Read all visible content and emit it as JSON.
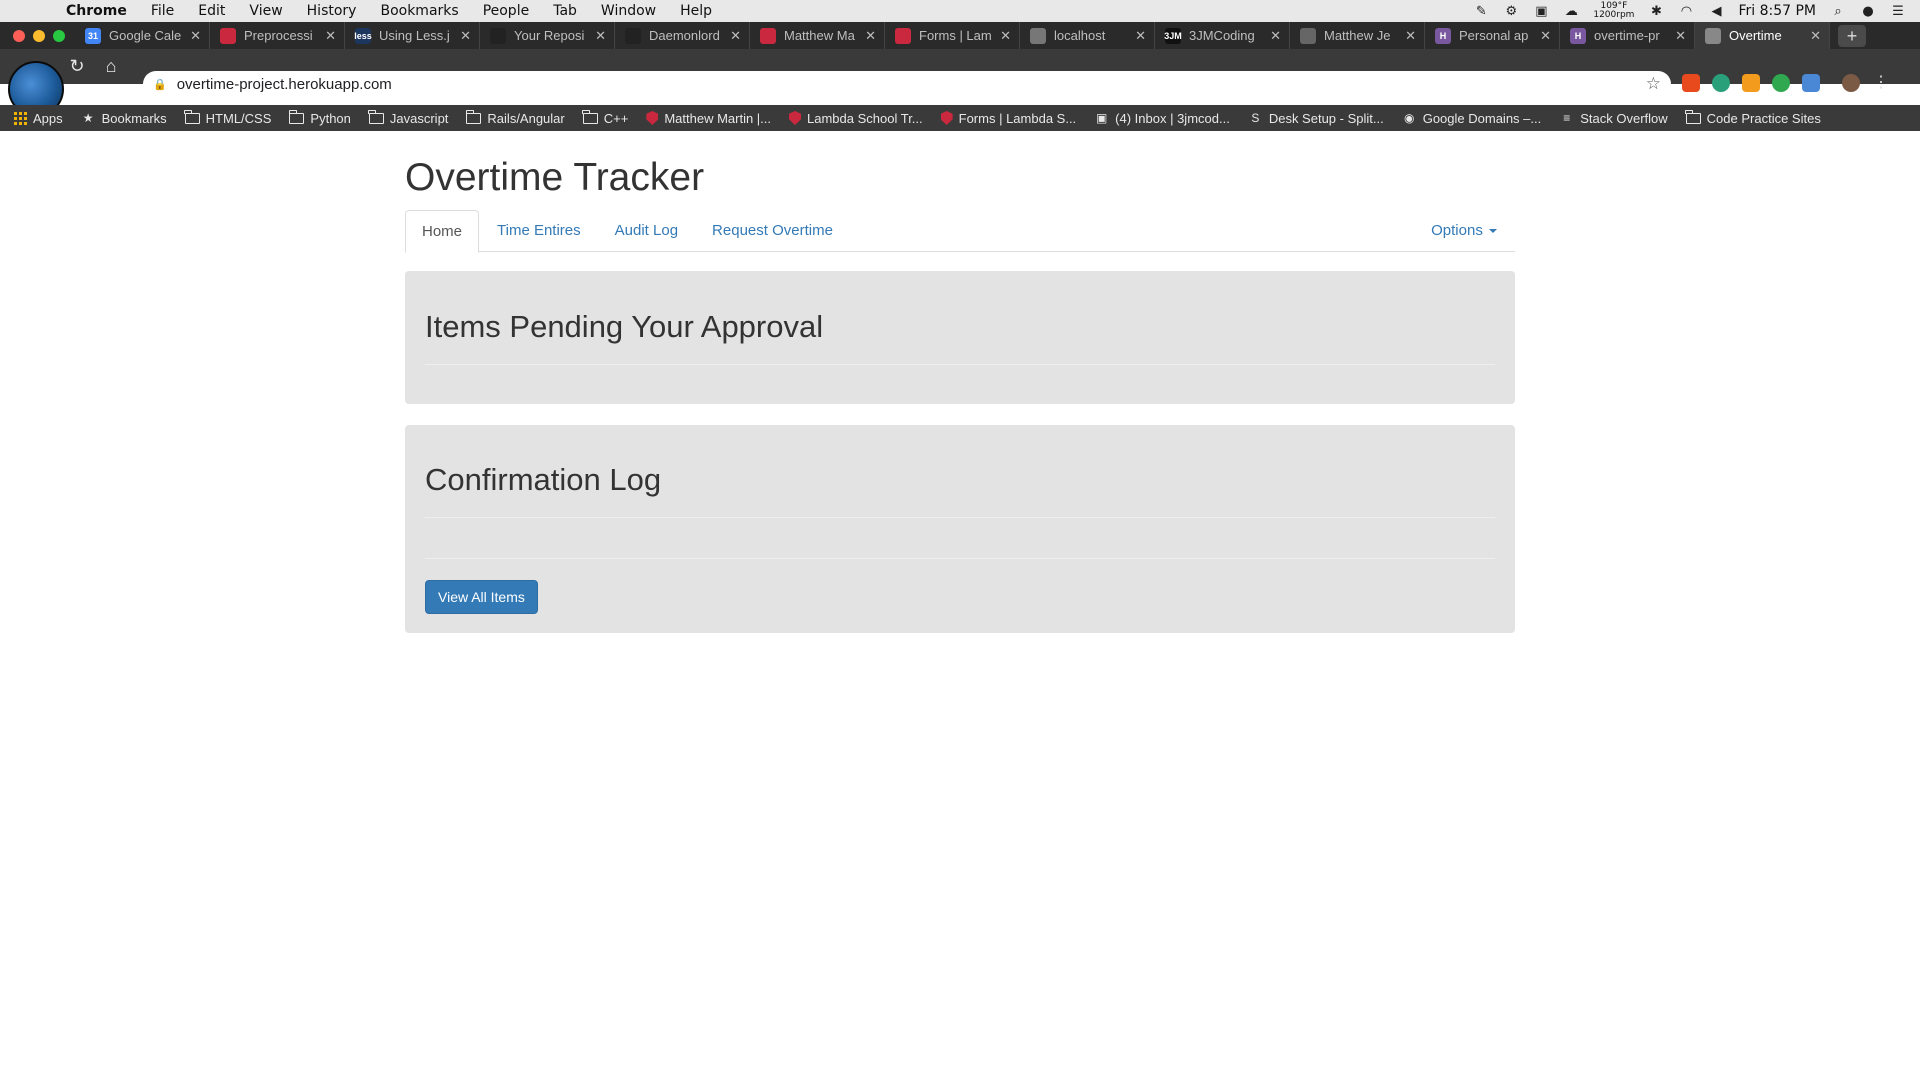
{
  "menubar": {
    "app": "Chrome",
    "items": [
      "File",
      "Edit",
      "View",
      "History",
      "Bookmarks",
      "People",
      "Tab",
      "Window",
      "Help"
    ],
    "temperature": "109°F",
    "fan": "1200rpm",
    "clock": "Fri 8:57 PM"
  },
  "tabs": [
    {
      "title": "Google Cale",
      "fav_color": "#4285f4",
      "fav_text": "31"
    },
    {
      "title": "Preprocessi",
      "fav_color": "#c9283e",
      "fav_text": ""
    },
    {
      "title": "Using Less.j",
      "fav_color": "#1d365d",
      "fav_text": "less"
    },
    {
      "title": "Your Reposi",
      "fav_color": "#222222",
      "fav_text": ""
    },
    {
      "title": "Daemonlord",
      "fav_color": "#222222",
      "fav_text": ""
    },
    {
      "title": "Matthew Ma",
      "fav_color": "#c9283e",
      "fav_text": ""
    },
    {
      "title": "Forms | Lam",
      "fav_color": "#c9283e",
      "fav_text": ""
    },
    {
      "title": "localhost",
      "fav_color": "#777777",
      "fav_text": ""
    },
    {
      "title": "3JMCoding",
      "fav_color": "#111111",
      "fav_text": "3JM"
    },
    {
      "title": "Matthew Je",
      "fav_color": "#666666",
      "fav_text": ""
    },
    {
      "title": "Personal ap",
      "fav_color": "#79589f",
      "fav_text": "H"
    },
    {
      "title": "overtime-pr",
      "fav_color": "#79589f",
      "fav_text": "H"
    },
    {
      "title": "Overtime",
      "fav_color": "#888888",
      "fav_text": "",
      "active": true
    }
  ],
  "address": {
    "url": "overtime-project.herokuapp.com"
  },
  "bookmarks": [
    {
      "label": "Apps",
      "icon": "apps-grid-icon"
    },
    {
      "label": "Bookmarks",
      "icon": "star-icon"
    },
    {
      "label": "HTML/CSS",
      "icon": "folder-icon"
    },
    {
      "label": "Python",
      "icon": "folder-icon"
    },
    {
      "label": "Javascript",
      "icon": "folder-icon"
    },
    {
      "label": "Rails/Angular",
      "icon": "folder-icon"
    },
    {
      "label": "C++",
      "icon": "folder-icon"
    },
    {
      "label": "Matthew Martin |...",
      "icon": "shield-icon"
    },
    {
      "label": "Lambda School Tr...",
      "icon": "shield-icon"
    },
    {
      "label": "Forms | Lambda S...",
      "icon": "shield-icon"
    },
    {
      "label": "(4) Inbox | 3jmcod...",
      "icon": "inbox-icon"
    },
    {
      "label": "Desk Setup - Split...",
      "icon": "s-icon"
    },
    {
      "label": "Google Domains –...",
      "icon": "globe-icon"
    },
    {
      "label": "Stack Overflow",
      "icon": "stackoverflow-icon"
    },
    {
      "label": "Code Practice Sites",
      "icon": "folder-icon"
    }
  ],
  "page": {
    "title": "Overtime Tracker",
    "nav": {
      "tabs": [
        "Home",
        "Time Entires",
        "Audit Log",
        "Request Overtime"
      ],
      "active": "Home",
      "options_label": "Options"
    },
    "pending": {
      "heading": "Items Pending Your Approval"
    },
    "log": {
      "heading": "Confirmation Log",
      "button": "View All Items"
    }
  },
  "colors": {
    "link": "#337ab7",
    "panel": "#e3e3e3",
    "button": "#337ab7"
  }
}
